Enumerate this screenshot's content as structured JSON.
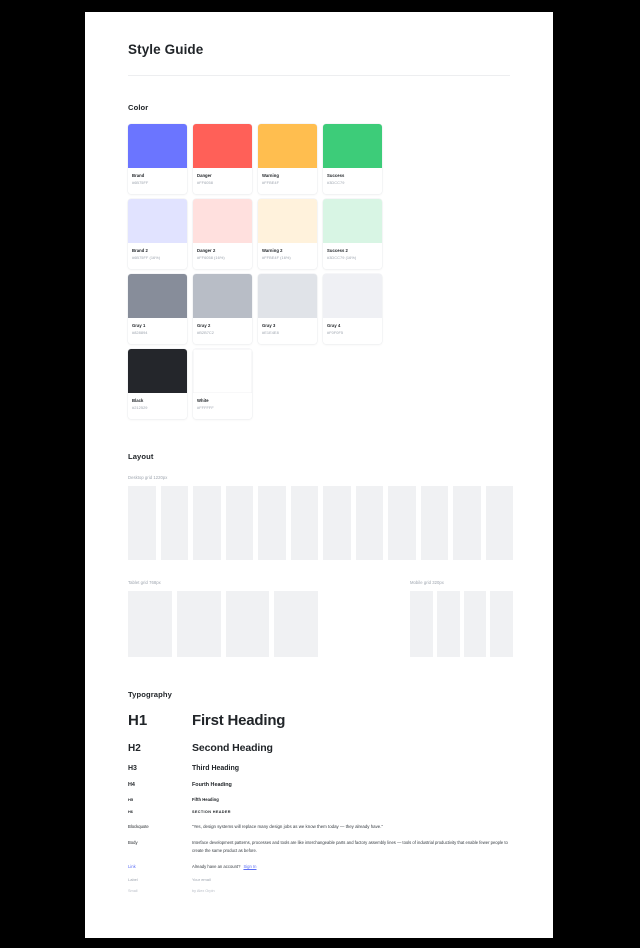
{
  "page": {
    "title": "Style Guide"
  },
  "sections": {
    "color": {
      "heading": "Color",
      "swatches": [
        {
          "name": "Brand",
          "hex": "#6B75FF",
          "color": "#6B75FF"
        },
        {
          "name": "Danger",
          "hex": "#FF6058",
          "color": "#FF6058"
        },
        {
          "name": "Warning",
          "hex": "#FFBE4F",
          "color": "#FFBE4F"
        },
        {
          "name": "Success",
          "hex": "#3DCC79",
          "color": "#3DCC79"
        },
        {
          "name": "Brand 2",
          "hex": "#6B75FF (16%)",
          "color": "#E1E3FF"
        },
        {
          "name": "Danger 2",
          "hex": "#FF6058 (16%)",
          "color": "#FFE0DE"
        },
        {
          "name": "Warning 2",
          "hex": "#FFBE4F (16%)",
          "color": "#FFF2DC"
        },
        {
          "name": "Success 2",
          "hex": "#3DCC79 (16%)",
          "color": "#D8F5E4"
        },
        {
          "name": "Gray 1",
          "hex": "#828894",
          "color": "#878D9A"
        },
        {
          "name": "Gray 2",
          "hex": "#B2B7C2",
          "color": "#B8BDC6"
        },
        {
          "name": "Gray 3",
          "hex": "#E1E4E8",
          "color": "#E0E3E8"
        },
        {
          "name": "Gray 4",
          "hex": "#F0F0F5",
          "color": "#EFF0F4"
        },
        {
          "name": "Black",
          "hex": "#212529",
          "color": "#24262B"
        },
        {
          "name": "White",
          "hex": "#FFFFFF",
          "color": "#FFFFFF"
        }
      ]
    },
    "layout": {
      "heading": "Layout",
      "desktop": {
        "caption": "Desktop grid 1220px",
        "columns": 12
      },
      "tablet": {
        "caption": "Tablet grid 768px",
        "columns": 4
      },
      "mobile": {
        "caption": "Mobile grid 320px",
        "columns": 4
      }
    },
    "typography": {
      "heading": "Typography",
      "rows": [
        {
          "label": "H1",
          "sample": "First Heading"
        },
        {
          "label": "H2",
          "sample": "Second Heading"
        },
        {
          "label": "H3",
          "sample": "Third Heading"
        },
        {
          "label": "H4",
          "sample": "Fourth Heading"
        },
        {
          "label": "H5",
          "sample": "Fifth Heading"
        },
        {
          "label": "H6",
          "sample": "Section header"
        },
        {
          "label": "Blockquote",
          "sample": "“Yes, design systems will replace many design jobs as we know them today — they already have.”"
        },
        {
          "label": "Body",
          "sample": "Interface development patterns, processes and tools are like interchangeable parts and factory assembly lines — tools of industrial productivity that enable fewer people to create the same product as before."
        },
        {
          "label": "Label",
          "sample": "Your email"
        },
        {
          "label": "Small",
          "sample": "by Alex Orpin"
        }
      ],
      "link_row": {
        "label": "Link",
        "text": "Already have an account?",
        "anchor": "Sign In"
      }
    }
  }
}
